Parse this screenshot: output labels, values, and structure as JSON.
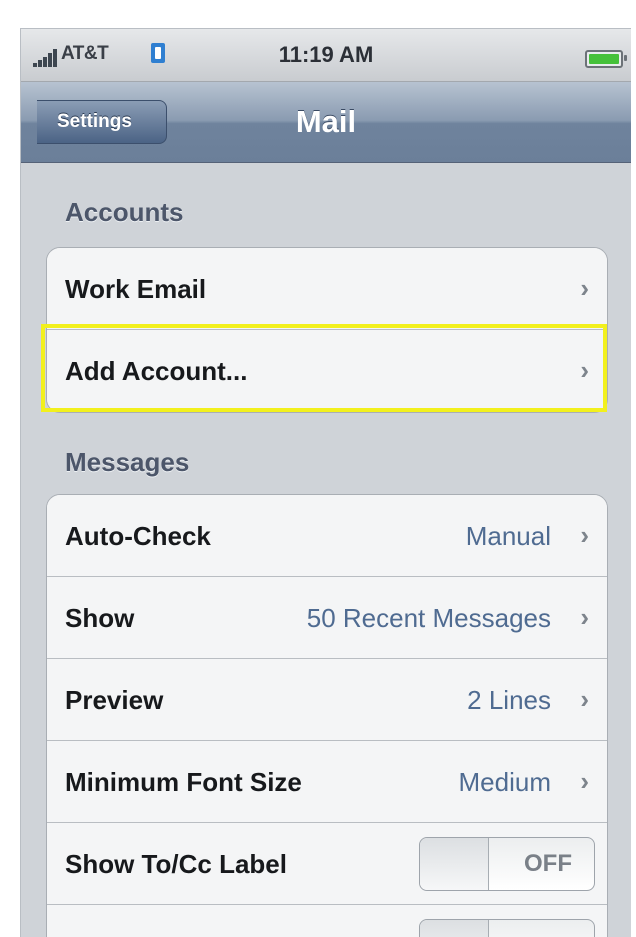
{
  "status_bar": {
    "carrier": "AT&T",
    "time": "11:19 AM"
  },
  "nav": {
    "back_label": "Settings",
    "title": "Mail"
  },
  "accounts": {
    "header": "Accounts",
    "items": [
      {
        "label": "Work Email"
      },
      {
        "label": "Add Account..."
      }
    ]
  },
  "messages": {
    "header": "Messages",
    "items": [
      {
        "label": "Auto-Check",
        "value": "Manual"
      },
      {
        "label": "Show",
        "value": "50 Recent Messages"
      },
      {
        "label": "Preview",
        "value": "2 Lines"
      },
      {
        "label": "Minimum Font Size",
        "value": "Medium"
      }
    ],
    "toggle_row": {
      "label": "Show To/Cc Label",
      "state": "OFF"
    }
  },
  "colors": {
    "nav_bar": "#7a8ca4",
    "background": "#cfd3d8",
    "value_text": "#4f6b91",
    "highlight": "#f2f01d"
  }
}
